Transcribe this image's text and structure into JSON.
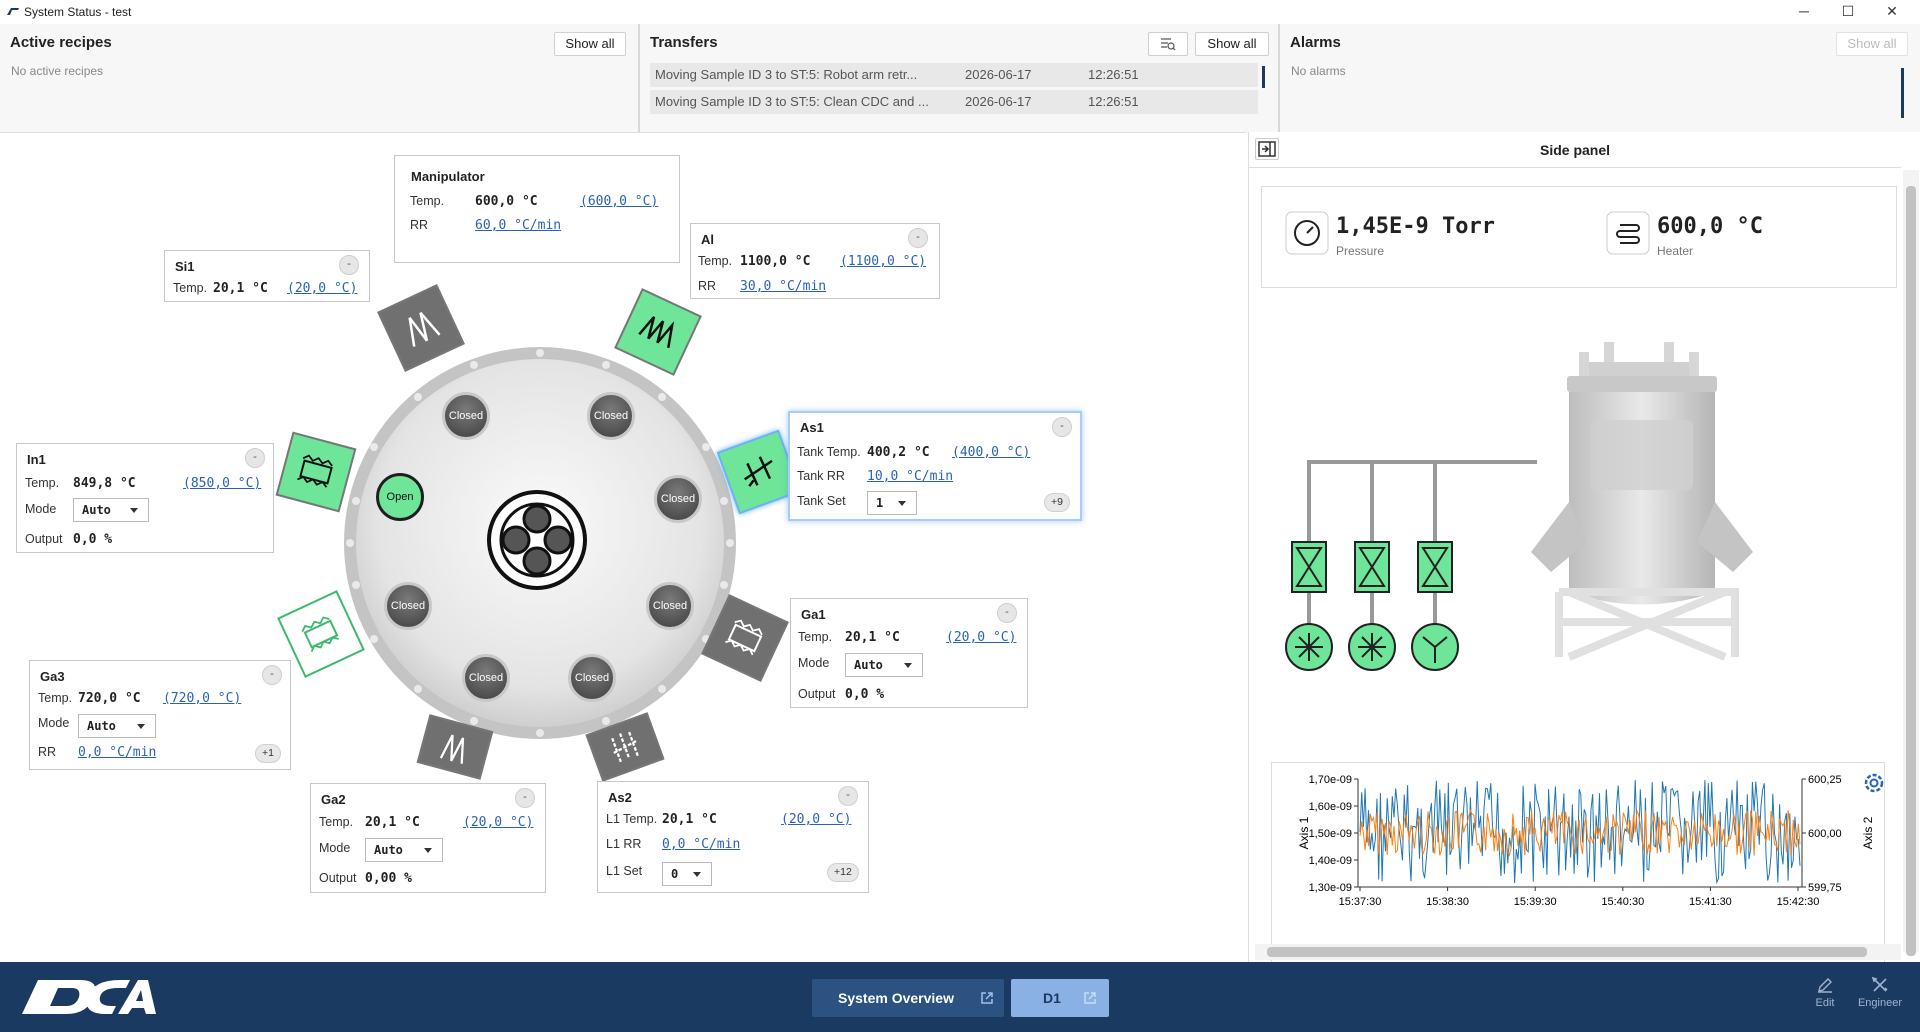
{
  "window": {
    "title": "System Status - test",
    "minimize": "─",
    "maximize": "☐",
    "close": "✕"
  },
  "recipes": {
    "title": "Active recipes",
    "show_all": "Show all",
    "empty": "No active recipes"
  },
  "transfers": {
    "title": "Transfers",
    "show_all": "Show all",
    "rows": [
      {
        "desc": "Moving Sample ID 3 to ST:5: Robot arm retr...",
        "date": "2026-06-17",
        "time": "12:26:51"
      },
      {
        "desc": "Moving Sample ID 3 to ST:5: Clean CDC and ...",
        "date": "2026-06-17",
        "time": "12:26:51"
      }
    ]
  },
  "alarms": {
    "title": "Alarms",
    "show_all": "Show all",
    "empty": "No alarms"
  },
  "ports": {
    "closed": "Closed",
    "open": "Open"
  },
  "cards": {
    "manipulator": {
      "name": "Manipulator",
      "temp_label": "Temp.",
      "temp": "600,0 °C",
      "temp_set": "(600,0 °C)",
      "rr_label": "RR",
      "rr": "60,0 °C/min"
    },
    "si1": {
      "name": "Si1",
      "temp_label": "Temp.",
      "temp": "20,1 °C",
      "temp_set": "(20,0 °C)",
      "btn": "-"
    },
    "al": {
      "name": "Al",
      "temp_label": "Temp.",
      "temp": "1100,0 °C",
      "temp_set": "(1100,0 °C)",
      "rr_label": "RR",
      "rr": "30,0 °C/min",
      "btn": "-"
    },
    "in1": {
      "name": "In1",
      "temp_label": "Temp.",
      "temp": "849,8 °C",
      "temp_set": "(850,0 °C)",
      "mode_label": "Mode",
      "mode": "Auto",
      "out_label": "Output",
      "out": "0,0 %",
      "btn": "-"
    },
    "as1": {
      "name": "As1",
      "temp_label": "Tank Temp.",
      "temp": "400,2 °C",
      "temp_set": "(400,0 °C)",
      "rr_label": "Tank RR",
      "rr": "10,0 °C/min",
      "set_label": "Tank Set",
      "set": "1",
      "more": "+9",
      "btn": "-"
    },
    "ga1": {
      "name": "Ga1",
      "temp_label": "Temp.",
      "temp": "20,1 °C",
      "temp_set": "(20,0 °C)",
      "mode_label": "Mode",
      "mode": "Auto",
      "out_label": "Output",
      "out": "0,0 %",
      "btn": "-"
    },
    "ga3": {
      "name": "Ga3",
      "temp_label": "Temp.",
      "temp": "720,0 °C",
      "temp_set": "(720,0 °C)",
      "mode_label": "Mode",
      "mode": "Auto",
      "rr_label": "RR",
      "rr": "0,0 °C/min",
      "more": "+1",
      "btn": "-"
    },
    "ga2": {
      "name": "Ga2",
      "temp_label": "Temp.",
      "temp": "20,1 °C",
      "temp_set": "(20,0 °C)",
      "mode_label": "Mode",
      "mode": "Auto",
      "out_label": "Output",
      "out": "0,00 %",
      "btn": "-"
    },
    "as2": {
      "name": "As2",
      "temp_label": "L1 Temp.",
      "temp": "20,1 °C",
      "temp_set": "(20,0 °C)",
      "rr_label": "L1 RR",
      "rr": "0,0 °C/min",
      "set_label": "L1 Set",
      "set": "0",
      "more": "+12",
      "btn": "-"
    }
  },
  "side": {
    "title": "Side panel",
    "pressure": {
      "value": "1,45E-9 Torr",
      "label": "Pressure"
    },
    "heater": {
      "value": "600,0 °C",
      "label": "Heater"
    }
  },
  "chart_data": {
    "type": "line",
    "ylabel": "Axis 1",
    "y2label": "Axis 2",
    "y_ticks": [
      "1,70e-09",
      "1,60e-09",
      "1,50e-09",
      "1,40e-09",
      "1,30e-09"
    ],
    "y2_ticks": [
      "600,25",
      "600,00",
      "599,75"
    ],
    "x_ticks": [
      "15:37:30",
      "15:38:30",
      "15:39:30",
      "15:40:30",
      "15:41:30",
      "15:42:30"
    ],
    "ylim": [
      1.3e-09,
      1.7e-09
    ],
    "y2lim": [
      599.75,
      600.25
    ],
    "colors": {
      "axis1": "#1f77b4",
      "axis2": "#ff7f0e"
    }
  },
  "bottom": {
    "overview": "System Overview",
    "d1": "D1",
    "edit": "Edit",
    "engineer": "Engineer"
  }
}
